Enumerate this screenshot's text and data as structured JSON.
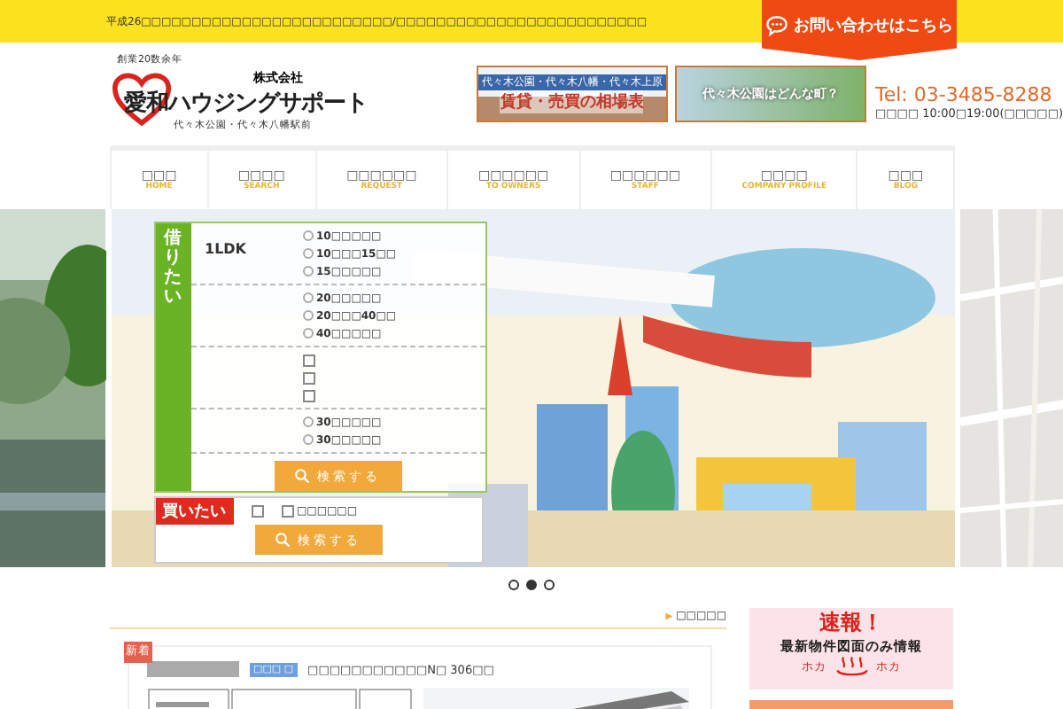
{
  "notice": "平成26□□□□□□□□□□□□□□□□□□□□□□□□□/□□□□□□□□□□□□□□□□□□□□□□□□□",
  "contact_button": "お問い合わせはこちら",
  "logo": {
    "tagline": "創業20数余年",
    "company_type": "株式会社",
    "name": "愛和ハウジングサポート",
    "location": "代々木公園・代々木八幡駅前"
  },
  "banners": [
    {
      "kind": "price",
      "subtitle": "代々木公園・代々木八幡・代々木上原",
      "title": "賃貸・売買の相場表"
    },
    {
      "kind": "town",
      "title": "代々木公園はどんな町？"
    }
  ],
  "phone": "Tel: 03-3485-8288",
  "hours": "□□□□ 10:00□19:00(□□□□□)",
  "nav": [
    {
      "label": "□□□",
      "sub": "HOME"
    },
    {
      "label": "□□□□",
      "sub": "SEARCH"
    },
    {
      "label": "□□□□□□",
      "sub": "REQUEST"
    },
    {
      "label": "□□□□□□",
      "sub": "TO OWNERS"
    },
    {
      "label": "□□□□□□",
      "sub": "STAFF"
    },
    {
      "label": "□□□□",
      "sub": "COMPANY PROFILE"
    },
    {
      "label": "□□□",
      "sub": "BLOG"
    }
  ],
  "rent_search": {
    "tab": "借りたい",
    "rows": [
      {
        "label": "1LDK",
        "options": [
          {
            "kind": "radio",
            "label": "10□□□□□",
            "checked": false
          },
          {
            "kind": "radio",
            "label": "10□□□15□□",
            "checked": false
          },
          {
            "kind": "radio",
            "label": "15□□□□□",
            "checked": false
          }
        ]
      },
      {
        "options": [
          {
            "kind": "radio",
            "label": "20□□□□□",
            "checked": false
          },
          {
            "kind": "radio",
            "label": "20□□□40□□",
            "checked": false
          },
          {
            "kind": "radio",
            "label": "40□□□□□",
            "checked": false
          }
        ]
      },
      {
        "options": [
          {
            "kind": "checkbox",
            "checked": false
          },
          {
            "kind": "checkbox",
            "checked": false
          },
          {
            "kind": "checkbox",
            "checked": false
          }
        ]
      },
      {
        "options": [
          {
            "kind": "radio",
            "label": "30□□□□□",
            "checked": false
          },
          {
            "kind": "radio",
            "label": "30□□□□□",
            "checked": false
          }
        ]
      }
    ],
    "button": "検索する"
  },
  "buy_search": {
    "tab": "買いたい",
    "options": [
      {
        "kind": "checkbox",
        "checked": false
      },
      {
        "kind": "checkbox",
        "label": "□□□□□□",
        "checked": false
      }
    ],
    "button": "検索する"
  },
  "slider_dots": [
    {
      "selected": false
    },
    {
      "selected": true
    },
    {
      "selected": false
    }
  ],
  "more_link": {
    "icon": "▶",
    "label": "□□□□□"
  },
  "listing": {
    "badge": "新着",
    "tag": "□□□ □",
    "title": "□□□□□□□□□□□N□ 306□□"
  },
  "side_banner": {
    "headline": "速報！",
    "text": "最新物件図面のみ情報",
    "left": "ホカ",
    "right": "ホカ"
  }
}
